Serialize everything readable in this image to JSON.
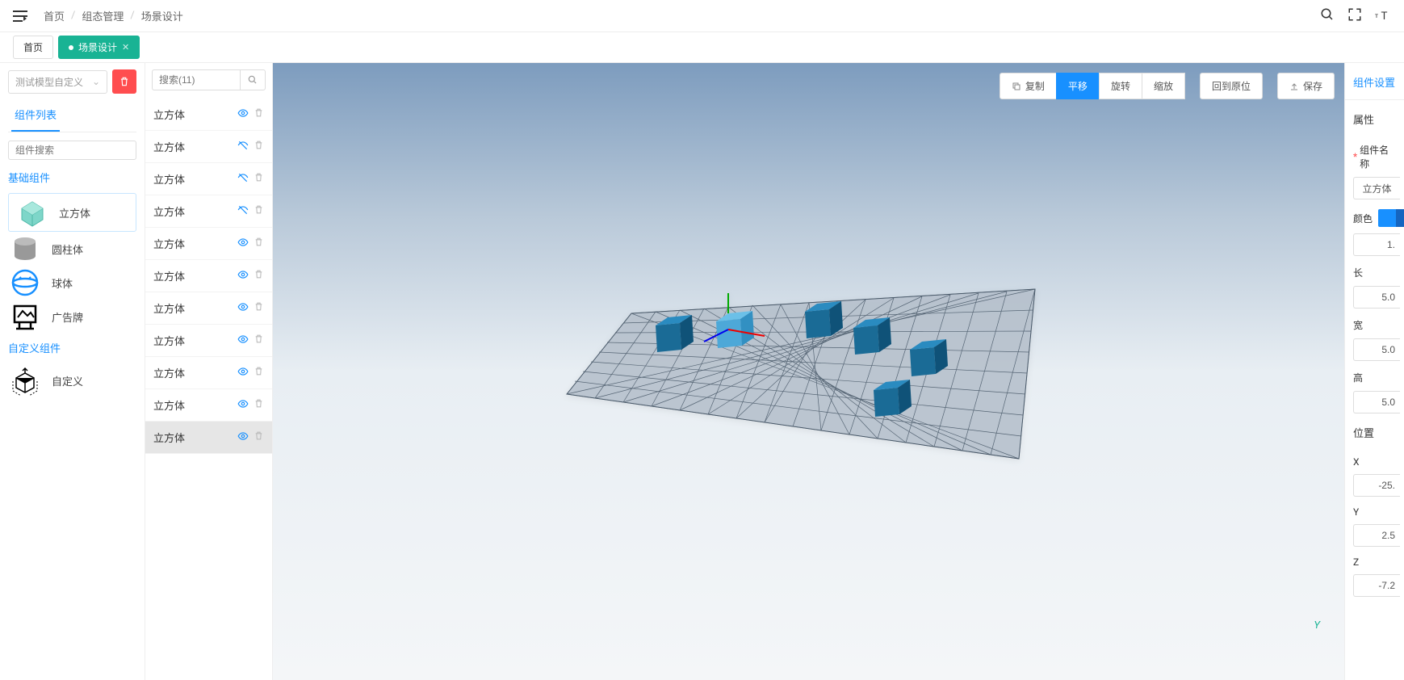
{
  "breadcrumb": {
    "home": "首页",
    "mid": "组态管理",
    "last": "场景设计"
  },
  "tabs": {
    "home": "首页",
    "scene": "场景设计"
  },
  "lib": {
    "model_select": "测试模型自定义",
    "tab_label": "组件列表",
    "search_placeholder": "组件搜索",
    "section_basic": "基础组件",
    "section_custom": "自定义组件",
    "items_basic": [
      "立方体",
      "圆柱体",
      "球体",
      "广告牌"
    ],
    "items_custom": [
      "自定义"
    ]
  },
  "objects": {
    "search_placeholder": "搜索(11)",
    "list": [
      {
        "name": "立方体",
        "vis": "eye",
        "selected": false
      },
      {
        "name": "立方体",
        "vis": "hide",
        "selected": false
      },
      {
        "name": "立方体",
        "vis": "hide",
        "selected": false
      },
      {
        "name": "立方体",
        "vis": "hide",
        "selected": false
      },
      {
        "name": "立方体",
        "vis": "eye",
        "selected": false
      },
      {
        "name": "立方体",
        "vis": "eye",
        "selected": false
      },
      {
        "name": "立方体",
        "vis": "eye",
        "selected": false
      },
      {
        "name": "立方体",
        "vis": "eye",
        "selected": false
      },
      {
        "name": "立方体",
        "vis": "eye",
        "selected": false
      },
      {
        "name": "立方体",
        "vis": "eye",
        "selected": false
      },
      {
        "name": "立方体",
        "vis": "eye",
        "selected": true
      }
    ]
  },
  "toolbar": {
    "copy": "复制",
    "move": "平移",
    "rotate": "旋转",
    "scale": "缩放",
    "reset": "回到原位",
    "save": "保存"
  },
  "axis_label": "Y",
  "props": {
    "tab": "组件设置",
    "section_attr": "属性",
    "label_name": "组件名称",
    "name_value": "立方体",
    "color_label": "颜色",
    "opacity_value": "1.",
    "length_label": "长",
    "length_value": "5.0",
    "width_label": "宽",
    "width_value": "5.0",
    "height_label": "高",
    "height_value": "5.0",
    "section_pos": "位置",
    "x_label": "X",
    "x_value": "-25.",
    "y_label": "Y",
    "y_value": "2.5",
    "z_label": "Z",
    "z_value": "-7.2"
  }
}
